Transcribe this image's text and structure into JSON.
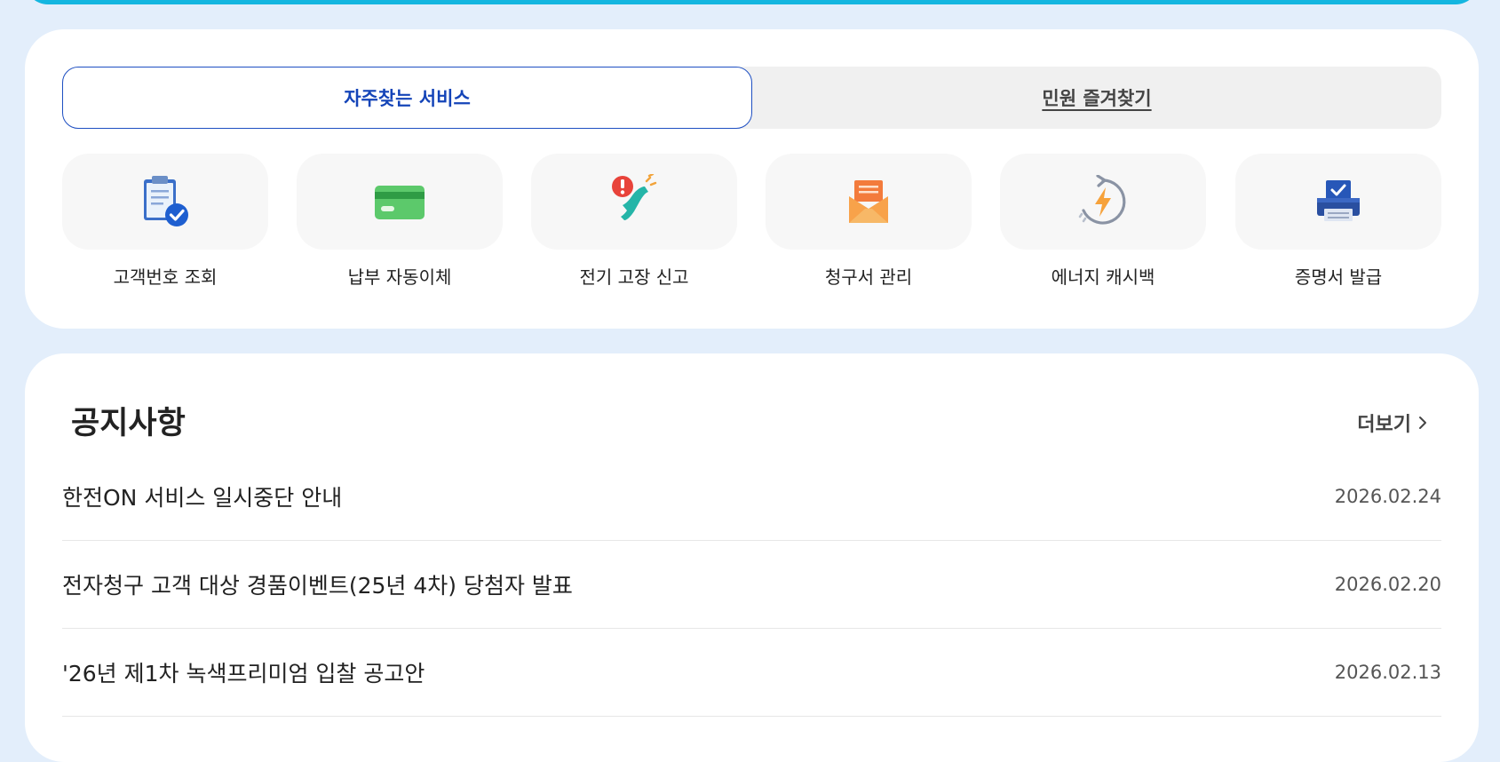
{
  "tabs": {
    "frequent": "자주찾는 서비스",
    "favorites": "민원 즐겨찾기"
  },
  "services": [
    {
      "label": "고객번호 조회",
      "icon": "clipboard-check-icon"
    },
    {
      "label": "납부 자동이체",
      "icon": "credit-card-icon"
    },
    {
      "label": "전기 고장 신고",
      "icon": "phone-alert-icon"
    },
    {
      "label": "청구서 관리",
      "icon": "envelope-icon"
    },
    {
      "label": "에너지 캐시백",
      "icon": "energy-refresh-icon"
    },
    {
      "label": "증명서 발급",
      "icon": "printer-icon"
    }
  ],
  "notice": {
    "title": "공지사항",
    "more": "더보기",
    "items": [
      {
        "text": "한전ON 서비스 일시중단 안내",
        "date": "2026.02.24"
      },
      {
        "text": "전자청구 고객 대상 경품이벤트(25년 4차) 당첨자 발표",
        "date": "2026.02.20"
      },
      {
        "text": "'26년 제1차 녹색프리미엄 입찰 공고안",
        "date": "2026.02.13"
      }
    ]
  },
  "colors": {
    "accent_blue": "#1444b8",
    "banner_cyan": "#14b6e0",
    "page_bg": "#e3eefb"
  }
}
